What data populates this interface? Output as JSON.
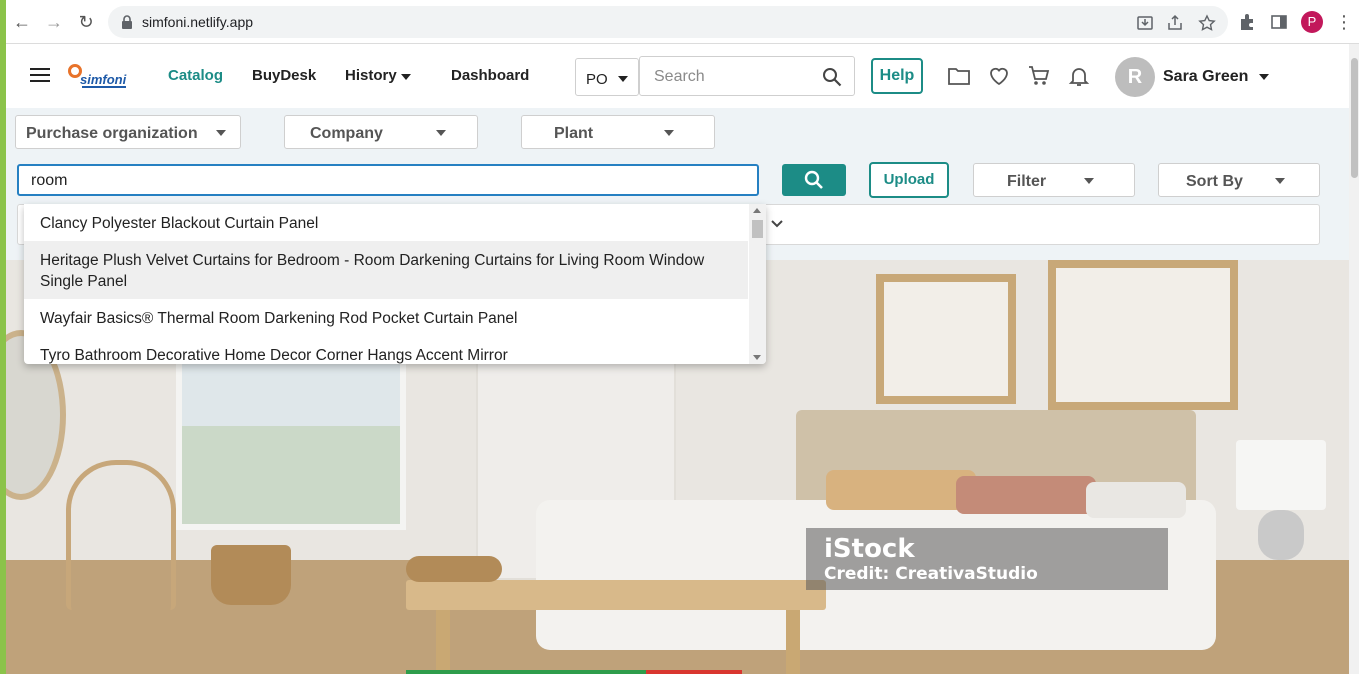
{
  "browser": {
    "url": "simfoni.netlify.app",
    "profile_initial": "P"
  },
  "header": {
    "logo_text": "simfoni",
    "nav": [
      {
        "label": "Catalog",
        "active": true
      },
      {
        "label": "BuyDesk",
        "active": false
      },
      {
        "label": "History",
        "active": false
      },
      {
        "label": "Dashboard",
        "active": false
      }
    ],
    "po_select": "PO",
    "search_placeholder": "Search",
    "help_label": "Help",
    "user": {
      "initial": "R",
      "name": "Sara Green"
    }
  },
  "filters": {
    "purchase_org": "Purchase organization",
    "company": "Company",
    "plant": "Plant"
  },
  "toolbar": {
    "search_value": "room",
    "upload_label": "Upload",
    "filter_label": "Filter",
    "sort_label": "Sort By"
  },
  "suggestions": [
    "Clancy Polyester Blackout Curtain Panel",
    "Heritage Plush Velvet Curtains for Bedroom - Room Darkening Curtains for Living Room Window Single Panel",
    "Wayfair Basics® Thermal Room Darkening Rod Pocket Curtain Panel",
    "Tyro Bathroom Decorative Home Decor Corner Hangs Accent Mirror"
  ],
  "hero": {
    "watermark_brand": "iStock",
    "watermark_credit": "Credit: CreativaStudio"
  },
  "colors": {
    "accent": "#1c8c86",
    "focus": "#2680c2",
    "brand_blue": "#1e5aa8",
    "brand_orange": "#e8732a"
  }
}
